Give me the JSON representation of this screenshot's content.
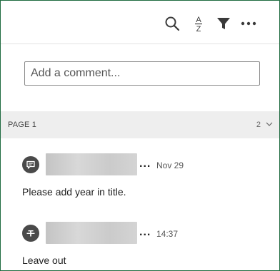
{
  "toolbar": {
    "search_icon": "search-icon",
    "sort_icon": "sort-az-icon",
    "filter_icon": "filter-icon",
    "more_icon": "more-icon"
  },
  "comment_input": {
    "placeholder": "Add a comment..."
  },
  "page_section": {
    "label": "PAGE 1",
    "count": "2"
  },
  "comments": [
    {
      "time": "Nov 29",
      "text": "Please add year in title.",
      "icon": "comment-icon"
    },
    {
      "time": "14:37",
      "text": "Leave out",
      "icon": "strikethrough-icon"
    }
  ],
  "colors": {
    "frame_border": "#1f6b40",
    "section_bg": "#eeeeee",
    "avatar_bg": "#4a4a4a"
  }
}
